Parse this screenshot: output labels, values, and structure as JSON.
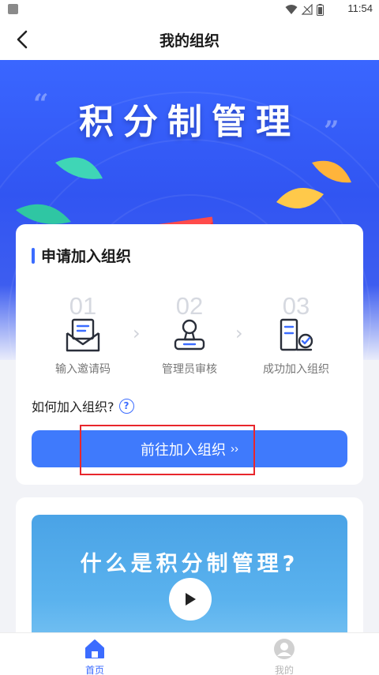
{
  "status_bar": {
    "time": "11:54"
  },
  "nav": {
    "title": "我的组织",
    "back_icon": "chevron-left-icon"
  },
  "hero": {
    "title": "积分制管理"
  },
  "apply_card": {
    "heading": "申请加入组织",
    "steps": [
      {
        "number": "01",
        "label": "输入邀请码",
        "icon": "mail-icon"
      },
      {
        "number": "02",
        "label": "管理员审核",
        "icon": "stamp-icon"
      },
      {
        "number": "03",
        "label": "成功加入组织",
        "icon": "verified-document-icon"
      }
    ],
    "howto_text": "如何加入组织?",
    "help_icon": "?",
    "join_button": {
      "label": "前往加入组织",
      "chevron": "››"
    }
  },
  "video_card": {
    "title": "什么是积分制管理?"
  },
  "tabbar": {
    "items": [
      {
        "label": "首页",
        "icon": "home-icon",
        "active": true
      },
      {
        "label": "我的",
        "icon": "profile-icon",
        "active": false
      }
    ]
  },
  "colors": {
    "accent": "#3f7afc",
    "hero_blue": "#3155f2",
    "highlight_red": "#e8262c"
  }
}
